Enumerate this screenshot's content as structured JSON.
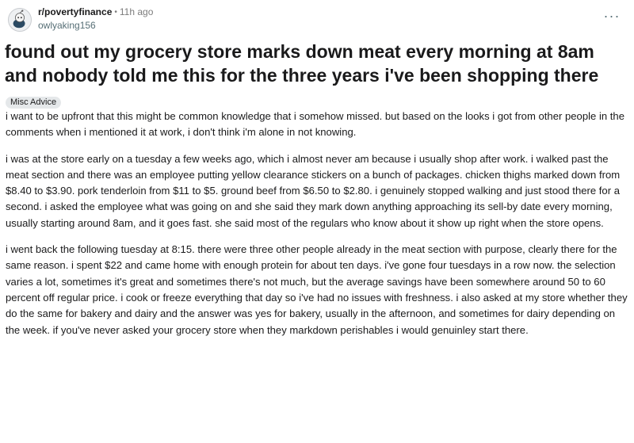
{
  "header": {
    "subreddit": "r/povertyfinance",
    "separator": "•",
    "time": "11h ago",
    "username": "owlyaking156",
    "avatar_icon": "snoo-avatar-icon",
    "more_icon": "more-options-icon",
    "more_glyph": "···"
  },
  "post": {
    "title": "found out my grocery store marks down meat every morning at 8am and nobody told me this for the three years i've been shopping there",
    "flair": "Misc Advice",
    "paragraphs": [
      "i want to be upfront that this might be common knowledge that i somehow missed. but based on the looks i got from other people in the comments when i mentioned it at work, i don't think i'm alone in not knowing.",
      "i was at the store early on a tuesday a few weeks ago, which i almost never am because i usually shop after work. i walked past the meat section and there was an employee putting yellow clearance stickers on a bunch of packages. chicken thighs marked down from $8.40 to $3.90. pork tenderloin from $11 to $5. ground beef from $6.50 to $2.80. i genuinely stopped walking and just stood there for a second. i asked the employee what was going on and she said they mark down anything approaching its sell-by date every morning, usually starting around 8am, and it goes fast. she said most of the regulars who know about it show up right when the store opens.",
      "i went back the following tuesday at 8:15. there were three other people already in the meat section with purpose, clearly there for the same reason. i spent $22 and came home with enough protein for about ten days. i've gone four tuesdays in a row now. the selection varies a lot, sometimes it's great and sometimes there's not much, but the average savings have been somewhere around 50 to 60 percent off regular price. i cook or freeze everything that day so i've had no issues with freshness. i also asked at my store whether they do the same for bakery and dairy and the answer was yes for bakery, usually in the afternoon, and sometimes for dairy depending on the week. if you've never asked your grocery store when they markdown perishables i would genuinley start there."
    ]
  }
}
